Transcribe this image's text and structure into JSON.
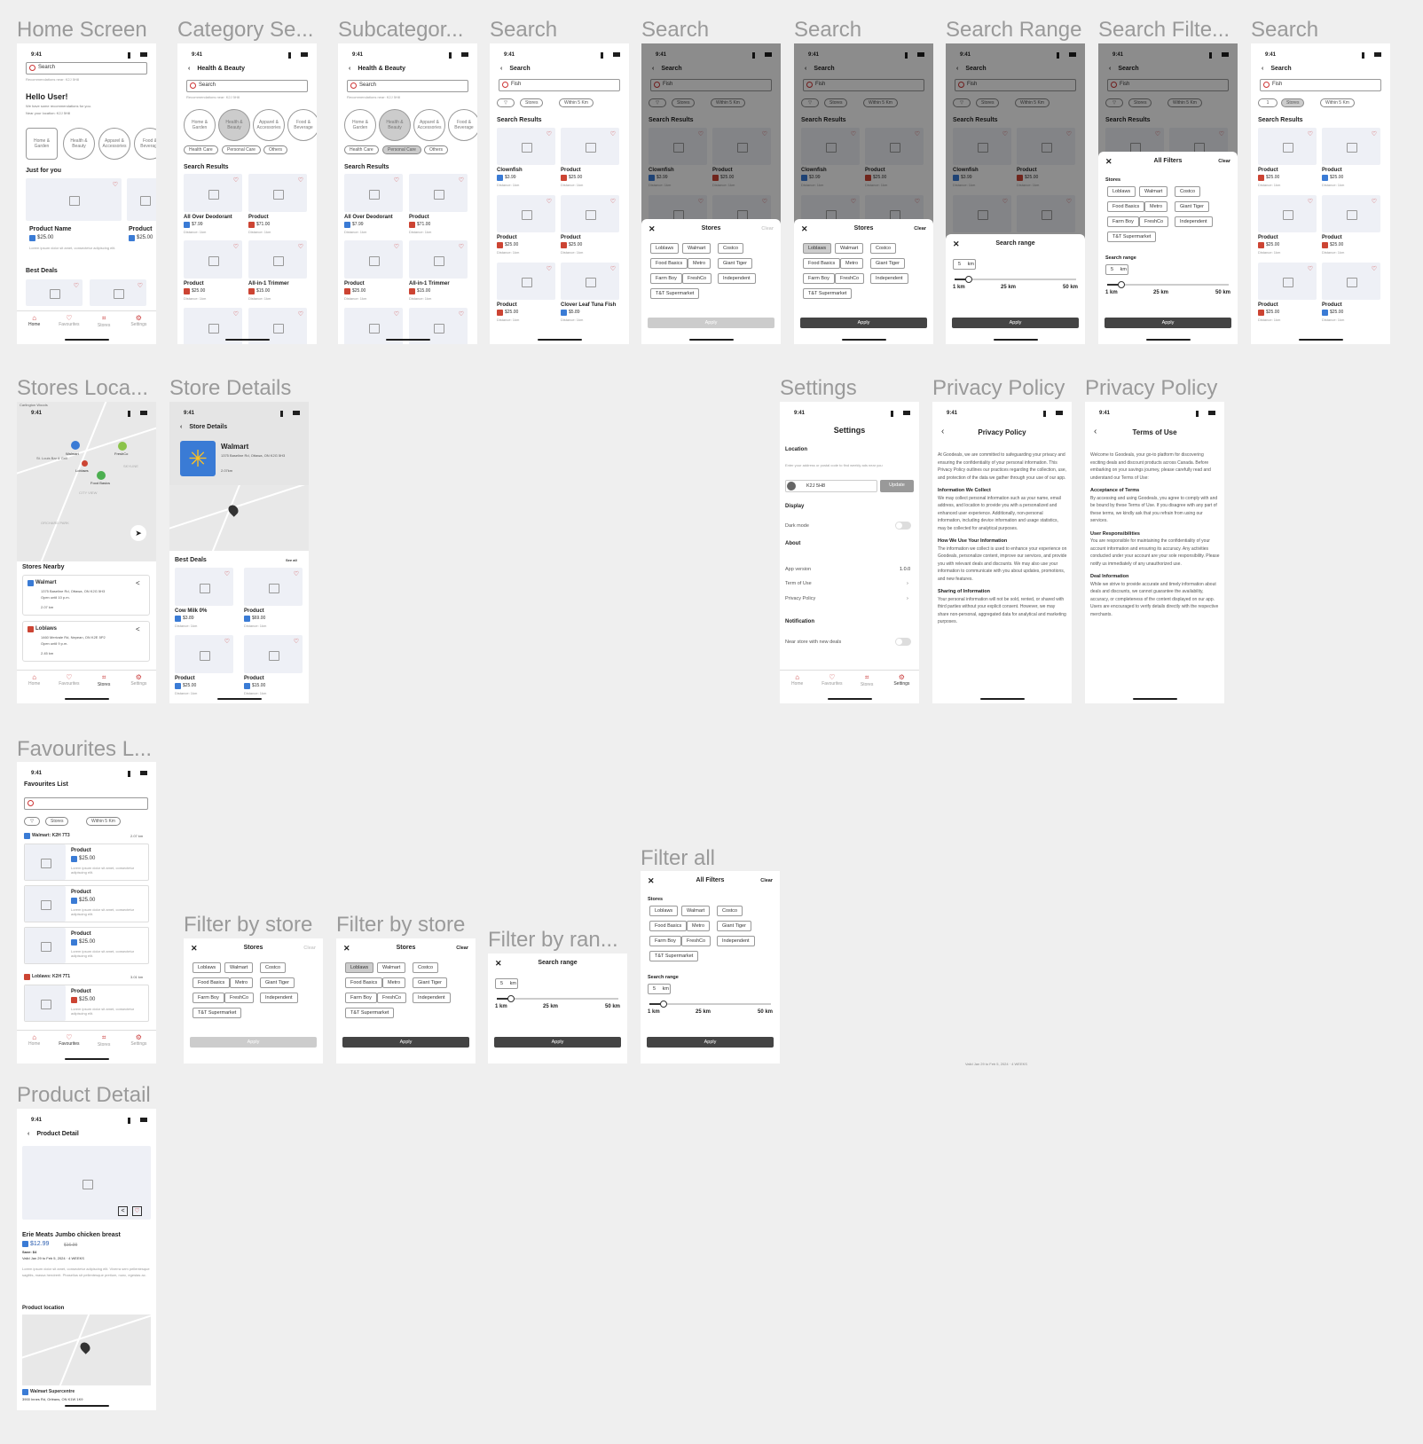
{
  "frames": {
    "f1": "Home Screen",
    "f2": "Category Se...",
    "f3": "Subcategor...",
    "f4": "Search",
    "f5": "Search",
    "f6": "Search",
    "f7": "Search Range",
    "f8": "Search Filte...",
    "f9": "Search",
    "f10": "Stores Loca...",
    "f11": "Store Details",
    "f12": "Settings",
    "f13": "Privacy Policy",
    "f14": "Privacy Policy",
    "f15": "Favourites L...",
    "f16": "Filter by store",
    "f17": "Filter by store",
    "f18": "Filter by ran...",
    "f19": "Filter all",
    "f20": "Product Detail"
  },
  "common": {
    "time": "9:41",
    "search": "Search",
    "fish": "Fish",
    "stores": "Stores",
    "within": "Within 5 Km",
    "results": "Search Results",
    "price": "$25.00",
    "distance": "Distance: 1km",
    "product": "Product",
    "apply": "Apply",
    "clear": "Clear",
    "stores_title": "Stores",
    "range_title": "Search range",
    "all_filters": "All Filters",
    "search_range_lbl": "Search range",
    "km_val": "5",
    "km_unit": "km",
    "r1": "1 km",
    "r2": "25 km",
    "r3": "50 km",
    "fav_count": "1"
  },
  "nav": {
    "home": "Home",
    "fav": "Favourites",
    "stores": "Stores",
    "settings": "Settings"
  },
  "store_chips": [
    "Loblaws",
    "Walmart",
    "Costco",
    "Food Basics",
    "Metro",
    "Giant Tiger",
    "Farm Boy",
    "FreshCo",
    "Independent",
    "T&T Supermarket"
  ],
  "home": {
    "search": "Search",
    "reco": "Recommendations near: K2J 5H8",
    "hello": "Hello User!",
    "sub1": "We have some recommendations for you.",
    "sub2": "Near your location: K2J 5H8",
    "cats": [
      "Home & Garden",
      "Health & Beauty",
      "Apparel & Accessories",
      "Food & Beverage"
    ],
    "just": "Just for you",
    "pname": "Product Name",
    "pprice": "$25.00",
    "pdesc": "Lorem ipsum dolor sit amet, consectetur adipiscing elit.",
    "pname2": "Product",
    "best": "Best Deals"
  },
  "category": {
    "title": "Health & Beauty",
    "reco": "Recommendations near: K2J 5H8",
    "cats": [
      "Home & Garden",
      "Health & Beauty",
      "Apparel & Accessories",
      "Food & Beverage"
    ],
    "subs": [
      "Health Care",
      "Personal Care",
      "Others"
    ],
    "p1": "All Over Deodorant",
    "p1p": "$7.99",
    "p2": "Product",
    "p2p": "$71.00",
    "p3": "Product",
    "p3p": "$25.00",
    "p4": "All-in-1 Trimmer",
    "p4p": "$15.00"
  },
  "search": {
    "p1": "Clownfish",
    "p1p": "$3.99",
    "p2": "Product",
    "p2p": "$25.00",
    "p3": "Product",
    "p4": "Product",
    "p5": "Product",
    "p6": "Clover Leaf Tuna Fish",
    "p6p": "$5.89"
  },
  "store_loc": {
    "area": "Carlington Woods",
    "nearby": "Stores Nearby",
    "s1": "Walmart",
    "s1a": "1375 Baseline Rd, Ottawa, ON K2G 5H3",
    "s1h": "Open until 10 p.m.",
    "s1d": "2.07 km",
    "s2": "Loblaws",
    "s2a": "1460 Merivale Rd, Nepean, ON K2E 5P2",
    "s2h": "Open until 9 p.m.",
    "s2d": "2.45 km",
    "m1": "Walmart",
    "m2": "FreshCo",
    "m3": "Loblaws",
    "m4": "Food Basics",
    "m5": "St. Louis Bar & Grill",
    "m6": "SKYLINE",
    "m7": "CITY VIEW",
    "m8": "ORCHARD PARK"
  },
  "store_det": {
    "title": "Store Details",
    "name": "Walmart",
    "addr": "1375 Baseline Rd, Ottawa, ON K2G 5H3",
    "dist": "2.07km",
    "best": "Best Deals",
    "see": "See all",
    "p1": "Cow Milk 0%",
    "p1p": "$3.89",
    "p2": "Product",
    "p2p": "$69.00",
    "p3": "Product",
    "p3p": "$25.00",
    "p4": "Product",
    "p4p": "$15.00"
  },
  "settings": {
    "title": "Settings",
    "loc": "Location",
    "loc_hint": "Enter your address or postal code to find weekly ads near you",
    "postal": "K2J 5H8",
    "update": "Update",
    "display": "Display",
    "dark": "Dark mode",
    "about": "About",
    "ver": "App version",
    "ver_v": "1.0.0",
    "terms": "Term of Use",
    "privacy": "Privacy Policy",
    "notif": "Notification",
    "near": "Near store with new deals"
  },
  "privacy": {
    "title": "Privacy Policy",
    "p1": "At Goodeals, we are committed to safeguarding your privacy and ensuring the confidentiality of your personal information. This Privacy Policy outlines our practices regarding the collection, use, and protection of the data we gather through your use of our app.",
    "h2": "Information We Collect",
    "p2": "We may collect personal information such as your name, email address, and location to provide you with a personalized and enhanced user experience. Additionally, non-personal information, including device information and usage statistics, may be collected for analytical purposes.",
    "h3": "How We Use Your Information",
    "p3": "The information we collect is used to enhance your experience on Goodeals, personalize content, improve our services, and provide you with relevant deals and discounts. We may also use your information to communicate with you about updates, promotions, and new features.",
    "h4": "Sharing of Information",
    "p4": "Your personal information will not be sold, rented, or shared with third parties without your explicit consent. However, we may share non-personal, aggregated data for analytical and marketing purposes."
  },
  "terms": {
    "title": "Terms of Use",
    "p1": "Welcome to Goodeals, your go-to platform for discovering exciting deals and discount products across Canada. Before embarking on your savings journey, please carefully read and understand our Terms of Use:",
    "h2": "Acceptance of Terms",
    "p2": "By accessing and using Goodeals, you agree to comply with and be bound by these Terms of Use. If you disagree with any part of these terms, we kindly ask that you refrain from using our services.",
    "h3": "User Responsibilities",
    "p3": "You are responsible for maintaining the confidentiality of your account information and ensuring its accuracy. Any activities conducted under your account are your sole responsibility. Please notify us immediately of any unauthorized use.",
    "h4": "Deal Information",
    "p4": "While we strive to provide accurate and timely information about deals and discounts, we cannot guarantee the availability, accuracy, or completeness of the content displayed on our app. Users are encouraged to verify details directly with the respective merchants."
  },
  "favs": {
    "title": "Favourites List",
    "g1": "Walmart: K2H 7T3",
    "g1d": "2.07 km",
    "g2": "Loblaws: K2H 7T1",
    "g2d": "3.01 km",
    "item": "Product",
    "price": "$25.00",
    "desc": "Lorem ipsum dolor sit amet, consectetur adipiscing elit."
  },
  "valid_note": "Valid Jan 29 to Feb 5, 2024 · 4 WEEKS",
  "product": {
    "title": "Product Detail",
    "name": "Erie Meats Jumbo chicken breast",
    "price": "$12.99",
    "old": "$16.99",
    "save": "Save: $4",
    "valid": "Valid Jan 29 to Feb 5, 2024 · 4 WEEKS",
    "desc": "Lorem ipsum dolor sit amet, consectetur adipiscing elit. Viverra sem pellentesque sagittis, massa hendrerit. Phasellus sit pellentesque pretium, nunc, egestas ac.",
    "loc": "Product location",
    "store": "Walmart Supercentre",
    "addr": "3900 Innes Rd, Orléans, ON K1W 1K9"
  }
}
